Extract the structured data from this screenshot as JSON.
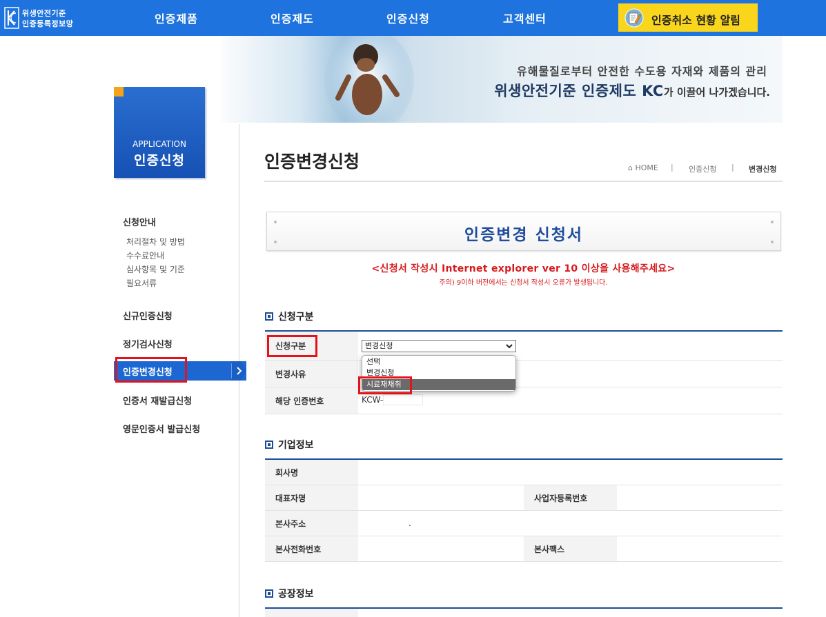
{
  "header": {
    "logo_line1": "위생안전기준",
    "logo_line2": "인증등록정보망",
    "nav": [
      "인증제품",
      "인증제도",
      "인증신청",
      "고객센터"
    ],
    "alert_label": "인증취소 현황 알림",
    "brand_color": "#1e73de",
    "alert_color": "#f9d51c"
  },
  "banner": {
    "line1": "유해물질로부터 안전한 수도용 자재와 제품의 관리",
    "line2_big": "위생안전기준 인증제도 KC",
    "line2_small": "가 이끌어 나가겠습니다."
  },
  "sidebar": {
    "box_en": "APPLICATION",
    "box_ko": "인증신청",
    "group_title": "신청안내",
    "sub_items": [
      "처리절차 및 방법",
      "수수료안내",
      "심사항목 및 기준",
      "필요서류"
    ],
    "items": [
      "신규인증신청",
      "정기검사신청",
      "인증변경신청",
      "인증서 재발급신청",
      "영문인증서 발급신청"
    ],
    "active_index": 2,
    "active_color": "#1d67d2"
  },
  "page": {
    "title": "인증변경신청",
    "breadcrumb": [
      "HOME",
      "인증신청",
      "변경신청"
    ]
  },
  "form": {
    "banner_title": "인증변경 신청서",
    "warning_main": "<신청서 작성시 Internet explorer ver 10 이상을 사용해주세요>",
    "warning_sub": "주의) 9이하 버전에서는 신청서 작성시 오류가 발생됩니다.",
    "warning_color": "#d7191c",
    "sections": {
      "application": {
        "title": "신청구분",
        "label_type": "신청구분",
        "select_value": "변경신청",
        "select_options": [
          "선택",
          "변경신청",
          "시료재채취"
        ],
        "highlighted_option_index": 2,
        "label_reason": "변경사유",
        "label_cert_no": "해당 인증번호",
        "cert_no_prefix": "KCW-"
      },
      "company": {
        "title": "기업정보",
        "label_name": "회사명",
        "label_ceo": "대표자명",
        "label_biz_no": "사업자등록번호",
        "label_address": "본사주소",
        "address_value": ".",
        "label_phone": "본사전화번호",
        "label_fax": "본사팩스"
      },
      "factory": {
        "title": "공장정보"
      }
    }
  }
}
